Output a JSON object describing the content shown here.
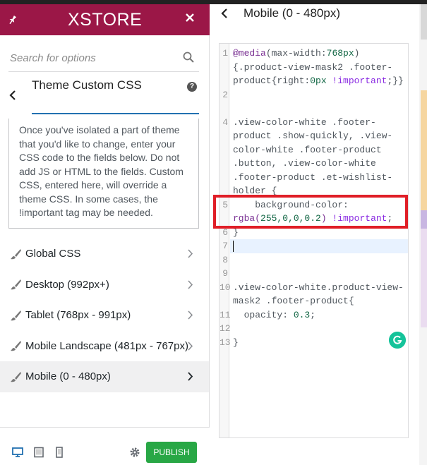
{
  "sidebar": {
    "logo": "XSTORE",
    "search_placeholder": "Search for options",
    "section_title": "Theme Custom CSS",
    "description": "Once you've isolated a part of theme that you'd like to change, enter your CSS code to the fields below. Do not add JS or HTML to the fields. Custom CSS, entered here, will override a theme CSS. In some cases, the !important tag may be needed.",
    "items": [
      {
        "label": "Global CSS",
        "active": false
      },
      {
        "label": "Desktop (992px+)",
        "active": false
      },
      {
        "label": "Tablet (768px - 991px)",
        "active": false
      },
      {
        "label": "Mobile Landscape (481px - 767px)",
        "active": false
      },
      {
        "label": "Mobile (0 - 480px)",
        "active": true
      }
    ],
    "publish_label": "PUBLISH"
  },
  "panel": {
    "title": "Mobile (0 - 480px)"
  },
  "editor": {
    "line_numbers": [
      "1",
      "",
      "",
      "2",
      "",
      "",
      "4",
      "",
      "",
      "",
      "",
      "",
      "5",
      "",
      "6",
      "7",
      "8",
      "9",
      "10",
      "",
      "11",
      "12",
      "13"
    ],
    "lines": [
      [
        "@media",
        "(max-width:",
        "768px",
        ")"
      ],
      [
        "{.product-view-mask2 .footer-"
      ],
      [
        "product{right:",
        "0px",
        " !important",
        ";}}"
      ],
      [
        ""
      ],
      [
        ""
      ],
      [
        ".view-color-white .footer-"
      ],
      [
        "product .show-quickly, .view-"
      ],
      [
        "color-white .footer-product"
      ],
      [
        ".button, .view-color-white"
      ],
      [
        ".footer-product .et-wishlist-"
      ],
      [
        "holder {"
      ],
      [
        "    background-color:"
      ],
      [
        "rgba(",
        "255,0,0,0.2",
        ")",
        " !important",
        ";"
      ],
      [
        "}"
      ],
      [
        ""
      ],
      [
        ""
      ],
      [
        ""
      ],
      [
        ".view-color-white.product-view-"
      ],
      [
        "mask2 .footer-product{"
      ],
      [
        "  opacity: ",
        "0.3",
        ";"
      ],
      [
        ""
      ],
      [
        "}"
      ]
    ]
  },
  "colors": {
    "brand": "#9b1747",
    "publish": "#28a745",
    "highlight": "#e01e27",
    "accent": "#2271b1"
  }
}
